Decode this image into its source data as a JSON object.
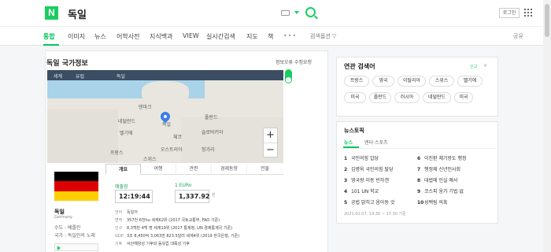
{
  "header": {
    "logo": "N",
    "query": "독일",
    "login": "로그인"
  },
  "nav": {
    "items": [
      "통합",
      "이미지",
      "뉴스",
      "어학사전",
      "지식백과",
      "VIEW",
      "실시간검색",
      "지도",
      "책"
    ],
    "dots": "•••",
    "tools": "검색옵션 ▽",
    "share": "공유"
  },
  "country_card": {
    "title": "독일 국가정보",
    "meta": "정보오류 수정요청",
    "map_header": [
      "세계",
      "유럽",
      "독일"
    ],
    "map_labels": [
      "덴마크",
      "네덜란드",
      "독일",
      "폴란드",
      "벨기에",
      "체코",
      "슬로바키아",
      "오스트리아",
      "헝가리",
      "스위스",
      "프랑스"
    ],
    "zoom_in": "+",
    "zoom_out": "−",
    "name": "독일",
    "name_en": "Germany",
    "side_lines": [
      "수도 : 베를린",
      "국가 : 독일인의 노래"
    ],
    "tabs": [
      "개요",
      "여행",
      "관련",
      "경제동향",
      "전물"
    ],
    "exchange": {
      "time_label": "매출정",
      "time": "12:19:44",
      "unit_label": "1 EURo",
      "rate": "1,337.92",
      "unit": "원"
    },
    "info": [
      {
        "k": "언어",
        "v": "독일어"
      },
      {
        "k": "면적",
        "v": "357천 6천hu 세계62위 (2017 국토교통부, FAO 기준)"
      },
      {
        "k": "인구",
        "v": "8,3백만 4백 명 세계19위 (2017 통계청, UN 경제통계국 기준)"
      },
      {
        "k": "GDP",
        "v": "3조 8,450억 3,063만 823.5달러 세계4위 (2019 한국은행, 기준)"
      },
      {
        "k": "기후",
        "v": "서안해양성 기후와 동유럽 대륙성 기후"
      }
    ]
  },
  "related": {
    "title": "연관 검색어",
    "meta": "신고",
    "close": "×",
    "chips": [
      "프랑스",
      "영국",
      "이탈리아",
      "스위스",
      "벨기에",
      "미국",
      "폴란드",
      "러시아",
      "네덜란드",
      "미국"
    ]
  },
  "news": {
    "title": "뉴스토픽",
    "tabs": [
      "뉴스",
      "엔터·스포츠"
    ],
    "items": [
      {
        "n": "1",
        "t": "국민의힘 압당"
      },
      {
        "n": "6",
        "t": "이진환 체기방도 행정"
      },
      {
        "n": "2",
        "t": "김병욱 국민의힘 탈당"
      },
      {
        "n": "7",
        "t": "행정제 신년인사회"
      },
      {
        "n": "3",
        "t": "영국왕 이동 빈하겐"
      },
      {
        "n": "8",
        "t": "대법에 인실 예서"
      },
      {
        "n": "4",
        "t": "101 UN 학교"
      },
      {
        "n": "9",
        "t": "코스피 웅가 기법 없"
      },
      {
        "n": "5",
        "t": "공법 밝히고 음아동 것"
      },
      {
        "n": "10",
        "t": "성백림 의혹"
      }
    ],
    "time": "2021.01.07. 14:30 ~ 17:30 기준"
  },
  "colors": {
    "accent": "#03c75a",
    "map_water": "#a9d3e8",
    "map_land": "#e8e6de",
    "flag": [
      "#000000",
      "#dd0000",
      "#ffce00"
    ]
  }
}
